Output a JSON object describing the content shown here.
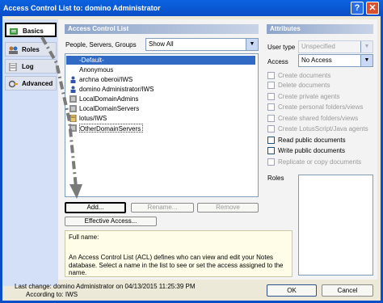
{
  "window": {
    "title": "Access Control List to: domino Administrator",
    "help_glyph": "?",
    "close_glyph": "✕"
  },
  "sidebar": {
    "items": [
      {
        "label": "Basics",
        "icon": "key-icon"
      },
      {
        "label": "Roles",
        "icon": "roles-icon"
      },
      {
        "label": "Log",
        "icon": "log-icon"
      },
      {
        "label": "Advanced",
        "icon": "advanced-icon"
      }
    ]
  },
  "acl": {
    "header": "Access Control List",
    "filter_label": "People, Servers, Groups",
    "filter_value": "Show All",
    "entries": [
      {
        "name": "-Default-",
        "icon": "none",
        "selected": true
      },
      {
        "name": "Anonymous",
        "icon": "none"
      },
      {
        "name": "archna oberoi/IWS",
        "icon": "person-icon"
      },
      {
        "name": "domino Administrator/IWS",
        "icon": "person-icon"
      },
      {
        "name": "LocalDomainAdmins",
        "icon": "group-icon"
      },
      {
        "name": "LocalDomainServers",
        "icon": "group-icon"
      },
      {
        "name": "lotus/IWS",
        "icon": "server-icon"
      },
      {
        "name": "OtherDomainServers",
        "icon": "group-icon"
      }
    ],
    "buttons": {
      "add": "Add...",
      "rename": "Rename...",
      "remove": "Remove",
      "effective": "Effective Access..."
    },
    "full_name_label": "Full name:",
    "help_text": "An Access Control List (ACL) defines who can view and edit your Notes database.  Select a name in the list to see or set the access assigned to the name."
  },
  "attributes": {
    "header": "Attributes",
    "user_type_label": "User type",
    "user_type_value": "Unspecified",
    "access_label": "Access",
    "access_value": "No Access",
    "options": [
      {
        "label": "Create documents",
        "enabled": false
      },
      {
        "label": "Delete documents",
        "enabled": false
      },
      {
        "label": "Create private agents",
        "enabled": false
      },
      {
        "label": "Create personal folders/views",
        "enabled": false
      },
      {
        "label": "Create shared folders/views",
        "enabled": false
      },
      {
        "label": "Create LotusScript/Java agents",
        "enabled": false
      },
      {
        "label": "Read public documents",
        "enabled": true
      },
      {
        "label": "Write public documents",
        "enabled": true
      },
      {
        "label": "Replicate or copy documents",
        "enabled": false
      }
    ],
    "roles_label": "Roles"
  },
  "footer": {
    "last_change": "Last change: domino Administrator on 04/13/2015 11:25:39 PM",
    "according_to": "According to: IWS",
    "ok": "OK",
    "cancel": "Cancel"
  },
  "colors": {
    "title_bar": "#0a4fc7",
    "selection": "#316ac5",
    "arrow": "#7a7a7a"
  }
}
